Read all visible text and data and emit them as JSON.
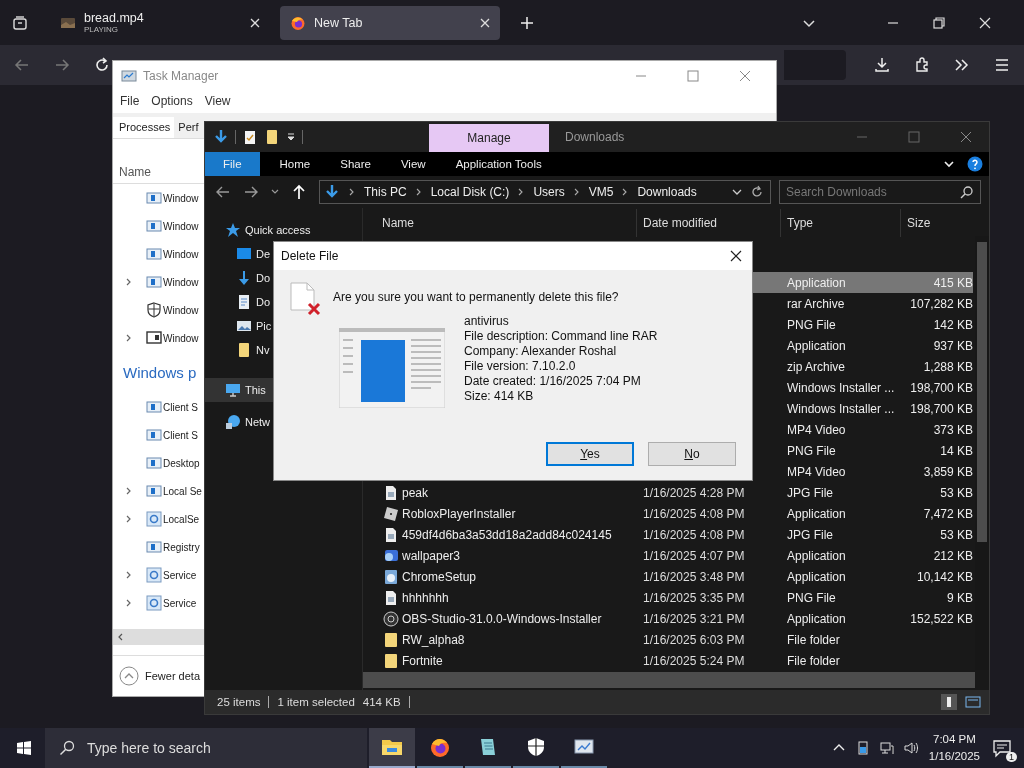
{
  "browser": {
    "tabs": [
      {
        "title": "bread.mp4",
        "subtitle": "PLAYING",
        "kind": "video",
        "selected": false
      },
      {
        "title": "New Tab",
        "kind": "firefox",
        "selected": true
      }
    ]
  },
  "task_manager": {
    "title": "Task Manager",
    "menu": [
      "File",
      "Options",
      "View"
    ],
    "tabs": [
      {
        "label": "Processes",
        "selected": true
      },
      {
        "label": "Perf",
        "selected": false
      }
    ],
    "column": "Name",
    "rows": [
      {
        "kind": "app",
        "name": "Window",
        "expandable": false
      },
      {
        "kind": "app",
        "name": "Window",
        "expandable": false
      },
      {
        "kind": "app",
        "name": "Window",
        "expandable": false
      },
      {
        "kind": "app",
        "name": "Window",
        "expandable": true
      },
      {
        "kind": "shield",
        "name": "Window",
        "expandable": false
      },
      {
        "kind": "monitor",
        "name": "Window",
        "expandable": true
      },
      {
        "kind": "group",
        "name": "Windows p"
      },
      {
        "kind": "app",
        "name": "Client S",
        "expandable": false
      },
      {
        "kind": "app",
        "name": "Client S",
        "expandable": false
      },
      {
        "kind": "app",
        "name": "Desktop",
        "expandable": false
      },
      {
        "kind": "app",
        "name": "Local Se",
        "expandable": true
      },
      {
        "kind": "gear",
        "name": "LocalSe",
        "expandable": true
      },
      {
        "kind": "app",
        "name": "Registry",
        "expandable": false
      },
      {
        "kind": "gear",
        "name": "Service",
        "expandable": true
      },
      {
        "kind": "gear",
        "name": "Service",
        "expandable": true
      }
    ],
    "footer": "Fewer deta"
  },
  "explorer": {
    "context_tab": "Manage",
    "title": "Downloads",
    "ribbon": [
      {
        "label": "File",
        "kind": "file"
      },
      {
        "label": "Home",
        "kind": "tab"
      },
      {
        "label": "Share",
        "kind": "tab"
      },
      {
        "label": "View",
        "kind": "tab"
      },
      {
        "label": "Application Tools",
        "kind": "tab"
      }
    ],
    "path": [
      "This PC",
      "Local Disk (C:)",
      "Users",
      "VM5",
      "Downloads"
    ],
    "search": {
      "placeholder": "Search Downloads"
    },
    "nav": [
      {
        "label": "Quick access",
        "kind": "star",
        "selected": false,
        "children": [
          {
            "label": "De",
            "kind": "desktop",
            "selected": false
          },
          {
            "label": "Do",
            "kind": "download",
            "selected": false
          },
          {
            "label": "Do",
            "kind": "document",
            "selected": false
          },
          {
            "label": "Pic",
            "kind": "pictures",
            "selected": false
          },
          {
            "label": "Nv",
            "kind": "folder",
            "selected": false
          }
        ]
      },
      {
        "label": "This",
        "kind": "pc",
        "selected": true
      },
      {
        "label": "Netw",
        "kind": "network",
        "selected": false
      }
    ],
    "columns": [
      "Name",
      "Date modified",
      "Type",
      "Size"
    ],
    "files": [
      {
        "type": "Application",
        "size": "415 KB",
        "selected": true
      },
      {
        "type": "rar Archive",
        "size": "107,282 KB",
        "selected": false
      },
      {
        "type": "PNG File",
        "size": "142 KB",
        "selected": false
      },
      {
        "type": "Application",
        "size": "937 KB",
        "selected": false
      },
      {
        "type": "zip Archive",
        "size": "1,288 KB",
        "selected": false
      },
      {
        "type": "Windows Installer ...",
        "size": "198,700 KB",
        "selected": false
      },
      {
        "type": "Windows Installer ...",
        "size": "198,700 KB",
        "selected": false
      },
      {
        "type": "MP4 Video",
        "size": "373 KB",
        "selected": false
      },
      {
        "type": "PNG File",
        "size": "14 KB",
        "selected": false
      },
      {
        "type": "MP4 Video",
        "size": "3,859 KB",
        "selected": false
      },
      {
        "name": "peak",
        "kind": "image",
        "date": "1/16/2025 4:28 PM",
        "type": "JPG File",
        "size": "53 KB",
        "selected": false
      },
      {
        "name": "RobloxPlayerInstaller",
        "kind": "tile",
        "date": "1/16/2025 4:08 PM",
        "type": "Application",
        "size": "7,472 KB",
        "selected": false
      },
      {
        "name": "459df4d6ba3a53dd18a2add84c024145",
        "kind": "image",
        "date": "1/16/2025 4:08 PM",
        "type": "JPG File",
        "size": "53 KB",
        "selected": false
      },
      {
        "name": "wallpaper3",
        "kind": "app",
        "date": "1/16/2025 4:07 PM",
        "type": "Application",
        "size": "212 KB",
        "selected": false
      },
      {
        "name": "ChromeSetup",
        "kind": "setup",
        "date": "1/16/2025 3:48 PM",
        "type": "Application",
        "size": "10,142 KB",
        "selected": false
      },
      {
        "name": "hhhhhhh",
        "kind": "image",
        "date": "1/16/2025 3:35 PM",
        "type": "PNG File",
        "size": "9 KB",
        "selected": false
      },
      {
        "name": "OBS-Studio-31.0.0-Windows-Installer",
        "kind": "disc",
        "date": "1/16/2025 3:21 PM",
        "type": "Application",
        "size": "152,522 KB",
        "selected": false
      },
      {
        "name": "RW_alpha8",
        "kind": "folder",
        "date": "1/16/2025 6:03 PM",
        "type": "File folder",
        "selected": false
      },
      {
        "name": "Fortnite",
        "kind": "folder",
        "date": "1/16/2025 5:24 PM",
        "type": "File folder",
        "selected": false
      }
    ],
    "status": [
      "25 items",
      "1 item selected",
      "414 KB"
    ]
  },
  "dialog": {
    "title": "Delete File",
    "question": "Are you sure you want to permanently delete this file?",
    "details": [
      "antivirus",
      "File description: Command line RAR",
      "Company: Alexander Roshal",
      "File version: 7.10.2.0",
      "Date created: 1/16/2025 7:04 PM",
      "Size: 414 KB"
    ],
    "buttons": [
      {
        "label": "Yes",
        "default": true
      },
      {
        "label": "No",
        "default": false
      }
    ]
  },
  "taskbar": {
    "search": {
      "placeholder": "Type here to search"
    },
    "apps": [
      {
        "kind": "explorer",
        "active": true
      },
      {
        "kind": "firefox",
        "active": false
      },
      {
        "kind": "notepad",
        "active": false
      },
      {
        "kind": "shield",
        "active": false
      },
      {
        "kind": "monitor",
        "active": false
      }
    ],
    "time": "7:04 PM",
    "date": "1/16/2025",
    "notifications": "1"
  }
}
